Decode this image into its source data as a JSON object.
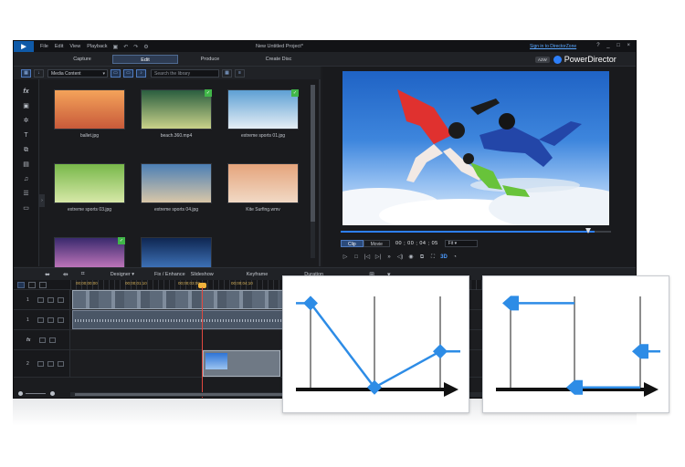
{
  "menu": {
    "items": [
      "File",
      "Edit",
      "View",
      "Playback"
    ],
    "project_title": "New Untitled Project*",
    "signin": "Sign in to DirectorZone",
    "window_buttons": "? _ □ ×"
  },
  "modes": {
    "capture": "Capture",
    "edit": "Edit",
    "produce": "Produce",
    "create_disc": "Create Disc",
    "brand_badge": "A2W",
    "brand_name": "PowerDirector"
  },
  "library": {
    "dropdown": "Media Content",
    "search_placeholder": "Search the library",
    "items": [
      {
        "label": "ballet.jpg",
        "colors": [
          "#f4a35a",
          "#c85a3a"
        ],
        "checked": false
      },
      {
        "label": "beach.360.mp4",
        "colors": [
          "#2a5e3f",
          "#c9d28a"
        ],
        "checked": true
      },
      {
        "label": "extreme sports 01.jpg",
        "colors": [
          "#5ea0d4",
          "#e5eef5"
        ],
        "checked": true
      },
      {
        "label": "extreme sports 03.jpg",
        "colors": [
          "#78b84a",
          "#d7e8a8"
        ],
        "checked": false
      },
      {
        "label": "extreme sports 04.jpg",
        "colors": [
          "#4c7fb5",
          "#d9c7a8"
        ],
        "checked": false
      },
      {
        "label": "Kite Surfing.wmv",
        "colors": [
          "#e5a47c",
          "#f1d9c5"
        ],
        "checked": false
      },
      {
        "label": "",
        "colors": [
          "#3a2a6e",
          "#e58bd0"
        ],
        "checked": true
      },
      {
        "label": "",
        "colors": [
          "#0f2752",
          "#4b87d4"
        ],
        "checked": false
      }
    ]
  },
  "preview": {
    "clip_label": "Clip",
    "movie_label": "Movie",
    "timecode": "00 ; 00 ; 04 ; 05",
    "fit": "Fit",
    "progress": 0.94
  },
  "timeline": {
    "designer_label": "Designer",
    "fix_label": "Fix / Enhance",
    "slideshow_label": "Slideshow",
    "keyframe_label": "Keyframe",
    "duration_label": "Duration",
    "ruler_marks": [
      "00;00;00;00",
      "00;00;01;10",
      "00;00;03;00",
      "00;00;04;10"
    ],
    "track_numbers": [
      "1",
      "1",
      "fx",
      "2"
    ]
  },
  "diagrams": {
    "linear_points": [
      [
        0,
        2.4
      ],
      [
        1,
        0.3
      ],
      [
        2,
        1.2
      ]
    ],
    "hold_points": [
      [
        0,
        2.4
      ],
      [
        1,
        0.3
      ],
      [
        2,
        1.2
      ]
    ],
    "accent": "#2d8ce6",
    "axis_color": "#111111"
  }
}
